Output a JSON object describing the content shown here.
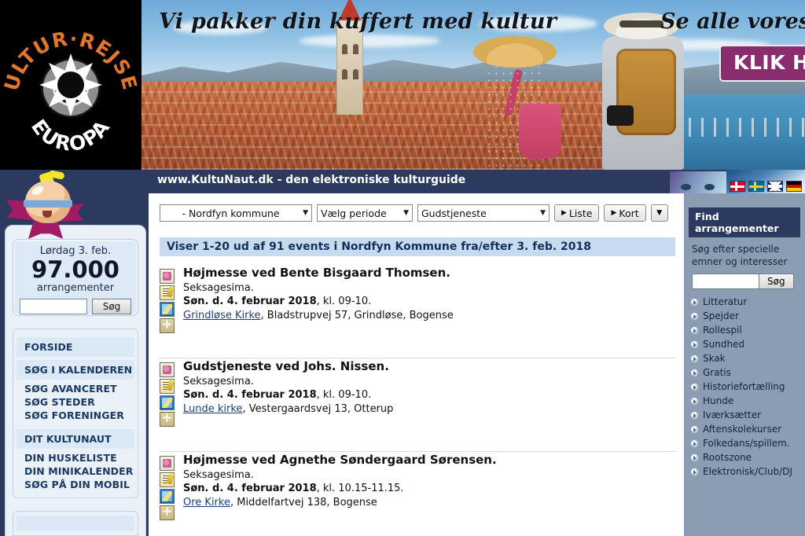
{
  "ad": {
    "logo_line1": "KULTUR·REJSER",
    "logo_line2": "EUROPA",
    "tagline_left": "Vi pakker din kuffert med kultur",
    "tagline_right": "Se alle vores rejser",
    "cta_label": "KLIK HER"
  },
  "header": {
    "title": "www.KultuNaut.dk - den elektroniske kulturguide",
    "flags": [
      "flag-denmark",
      "flag-sweden",
      "flag-uk",
      "flag-germany"
    ]
  },
  "left_sidebar": {
    "counter": {
      "day": "Lørdag 3. feb.",
      "number": "97.000",
      "label": "arrangementer",
      "search_value": "",
      "search_button": "Søg"
    },
    "sections": [
      {
        "head": "FORSIDE",
        "links": []
      },
      {
        "head": "SØG I KALENDEREN",
        "links": [
          "SØG AVANCERET",
          "SØG STEDER",
          "SØG FORENINGER"
        ]
      },
      {
        "head": "DIT KULTUNAUT",
        "links": [
          "DIN HUSKELISTE",
          "DIN MINIKALENDER",
          "SØG PÅ DIN MOBIL"
        ]
      }
    ]
  },
  "toolbar": {
    "area_select": "- Nordfyn kommune",
    "period_select": "Vælg periode",
    "type_select": "Gudstjeneste",
    "list_button": "Liste",
    "map_button": "Kort",
    "more_button": "▼"
  },
  "results": {
    "banner": "Viser 1-20 ud af 91 events i Nordfyn Kommune fra/efter 3. feb. 2018",
    "events": [
      {
        "title": "Højmesse ved Bente Bisgaard Thomsen.",
        "subtitle": "Seksagesima.",
        "date": "Søn. d. 4. februar 2018",
        "time": ", kl. 09-10.",
        "venue": "Grindløse Kirke",
        "address": ", Bladstrupvej 57, Grindløse, Bogense"
      },
      {
        "title": "Gudstjeneste ved Johs. Nissen.",
        "subtitle": "Seksagesima.",
        "date": "Søn. d. 4. februar 2018",
        "time": ", kl. 09-10.",
        "venue": "Lunde kirke",
        "address": ", Vestergaardsvej 13, Otterup"
      },
      {
        "title": "Højmesse ved Agnethe Søndergaard Sørensen.",
        "subtitle": "Seksagesima.",
        "date": "Søn. d. 4. februar 2018",
        "time": ", kl. 10.15-11.15.",
        "venue": "Ore Kirke",
        "address": ", Middelfartvej 138, Bogense"
      }
    ],
    "icons": [
      "poster-icon",
      "note-icon",
      "map-icon",
      "add-icon"
    ]
  },
  "right_sidebar": {
    "head": "Find arrangementer",
    "intro": "Søg efter specielle emner og interesser",
    "search_value": "",
    "search_button": "Søg",
    "topics": [
      "Litteratur",
      "Spejder",
      "Rollespil",
      "Sundhed",
      "Skak",
      "Gratis",
      "Historiefortælling",
      "Hunde",
      "Iværksætter",
      "Aftenskolekurser",
      "Folkedans/spillem.",
      "Rootszone",
      "Elektronisk/Club/DJ"
    ]
  },
  "colors": {
    "header_navy": "#2b3a5e",
    "banner_blue": "#c8daee",
    "right_panel": "#8b9db3",
    "link_blue": "#1a3f7a",
    "cta_purple": "#8a2d6e"
  }
}
